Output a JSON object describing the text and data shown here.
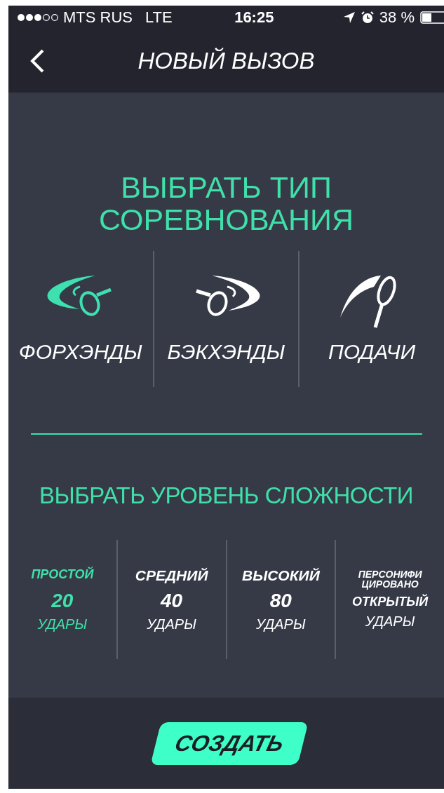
{
  "status_bar": {
    "carrier": "MTS RUS",
    "network": "LTE",
    "time": "16:25",
    "battery": "38 %"
  },
  "nav_bar": {
    "title": "НОВЫЙ ВЫЗОВ"
  },
  "competition": {
    "heading": "ВЫБРАТЬ ТИП СОРЕВНОВАНИЯ",
    "types": [
      {
        "kind": "forehand",
        "label": "ФОРХЭНДЫ",
        "selected": true
      },
      {
        "kind": "backhand",
        "label": "БЭКХЭНДЫ",
        "selected": false
      },
      {
        "kind": "serve",
        "label": "ПОДАЧИ",
        "selected": false
      }
    ]
  },
  "difficulty": {
    "heading": "ВЫБРАТЬ УРОВЕНЬ СЛОЖНОСТИ",
    "levels": [
      {
        "kind": "preset",
        "name": "ПРОСТОЙ",
        "count": "20",
        "unit": "УДАРЫ",
        "selected": true
      },
      {
        "kind": "preset",
        "name": "СРЕДНИЙ",
        "count": "40",
        "unit": "УДАРЫ",
        "selected": false
      },
      {
        "kind": "preset",
        "name": "ВЫСОКИЙ",
        "count": "80",
        "unit": "УДАРЫ",
        "selected": false
      },
      {
        "kind": "custom",
        "name": "ПЕРСОНИФИЦИРОВАНО",
        "count": "ОТКРЫТЫЙ",
        "unit": "УДАРЫ",
        "selected": false
      }
    ]
  },
  "create_button": {
    "label": "СОЗДАТЬ"
  }
}
